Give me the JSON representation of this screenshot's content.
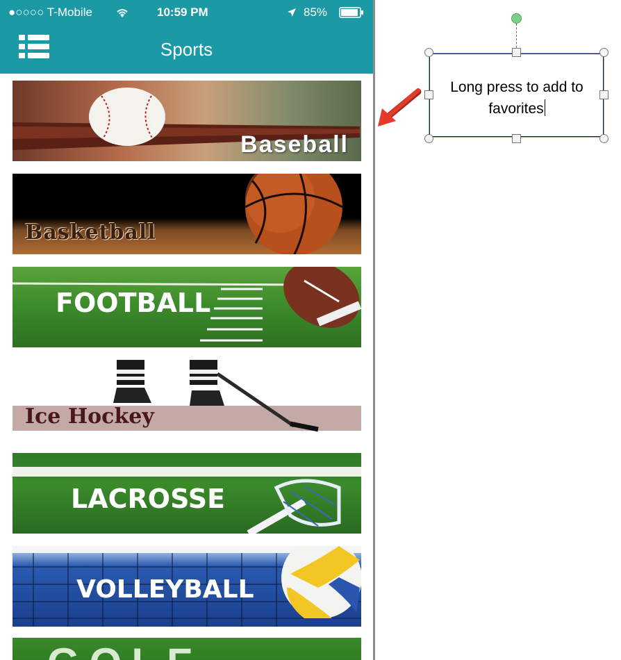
{
  "status_bar": {
    "carrier": "●○○○○ T-Mobile",
    "wifi_icon": "wifi-icon",
    "time": "10:59 PM",
    "location_icon": "location-arrow-icon",
    "battery": "85%",
    "battery_icon": "battery-icon"
  },
  "nav": {
    "title": "Sports",
    "menu_icon": "list-menu-icon"
  },
  "sports": [
    {
      "label": "Baseball"
    },
    {
      "label": "Basketball"
    },
    {
      "label": "FOOTBALL"
    },
    {
      "label": "Ice Hockey"
    },
    {
      "label": "LACROSSE"
    },
    {
      "label": "VOLLEYBALL"
    },
    {
      "label": "GOLF"
    }
  ],
  "annotation": {
    "text": "Long press to add to favorites",
    "arrow_color": "#e53a2a"
  },
  "colors": {
    "accent": "#1b9aa6"
  }
}
